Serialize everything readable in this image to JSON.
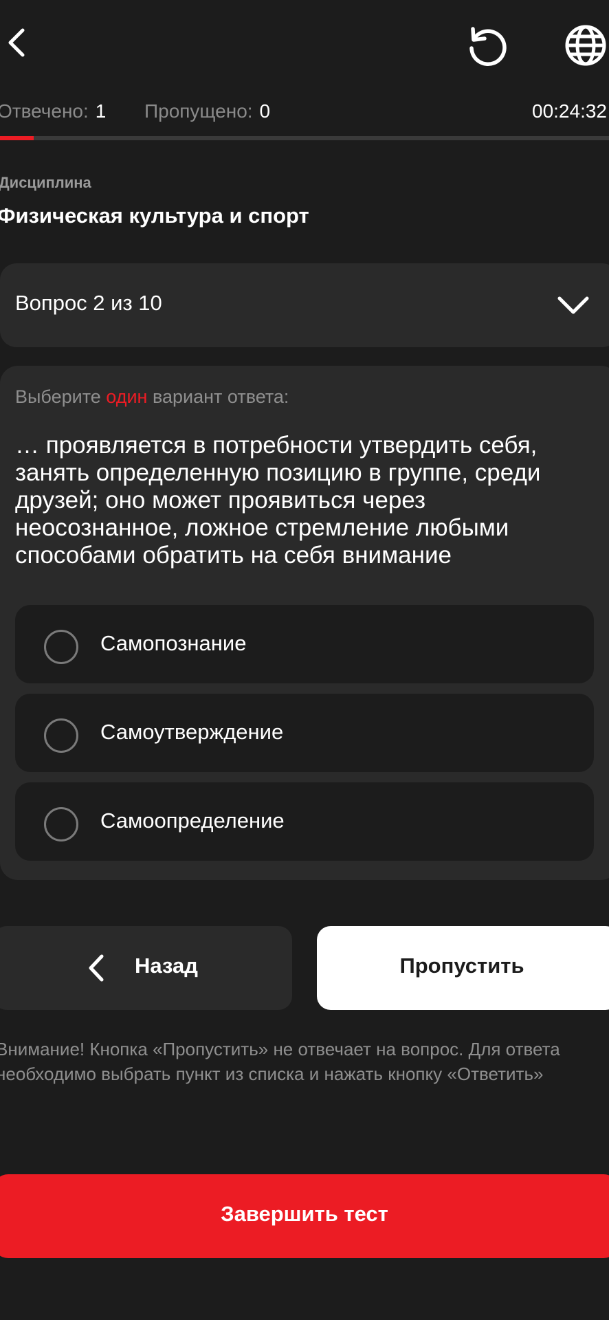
{
  "header": {
    "back_icon": "chevron-left-icon",
    "reload_icon": "reload-icon",
    "language_icon": "globe-icon"
  },
  "stats": {
    "answered_label": "Отвечено:",
    "answered_value": "1",
    "skipped_label": "Пропущено:",
    "skipped_value": "0",
    "timer": "00:24:32"
  },
  "progress": {
    "fraction": 0.055,
    "color": "#ec1c24"
  },
  "discipline": {
    "label": "Дисциплина",
    "title": "Физическая культура и спорт"
  },
  "question_selector": {
    "label": "Вопрос 2 из 10",
    "icon": "chevron-down-icon"
  },
  "question": {
    "instruction_prefix": "Выберите ",
    "instruction_highlight": "один",
    "instruction_suffix": " вариант ответа:",
    "text": "… проявляется в потребности утвердить себя, занять определенную позицию в группе, среди друзей; оно может проявиться через неосознанное, ложное стремление любыми способами обратить на себя внимание",
    "options": [
      {
        "label": "Самопознание"
      },
      {
        "label": "Самоутверждение"
      },
      {
        "label": "Самоопределение"
      }
    ]
  },
  "navigation": {
    "back_label": "Назад",
    "skip_label": "Пропустить"
  },
  "notice": "Внимание! Кнопка «Пропустить» не отвечает на вопрос. Для ответа необходимо выбрать пункт из списка и нажать кнопку «Ответить»",
  "finish_label": "Завершить тест",
  "colors": {
    "background": "#1c1c1c",
    "card": "#2a2a2a",
    "accent": "#ec1c24",
    "muted_text": "#8f8f8f"
  }
}
